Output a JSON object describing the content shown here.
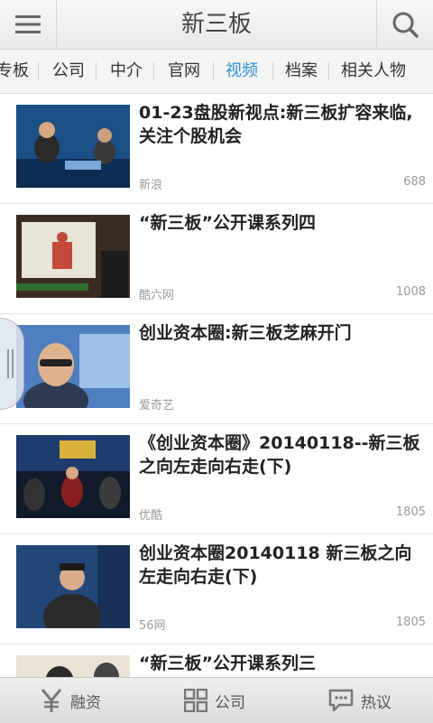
{
  "header": {
    "title": "新三板"
  },
  "tabs": [
    {
      "label": "专板"
    },
    {
      "label": "公司"
    },
    {
      "label": "中介"
    },
    {
      "label": "官网"
    },
    {
      "label": "视频",
      "active": true
    },
    {
      "label": "档案"
    },
    {
      "label": "相关人物"
    }
  ],
  "videos": [
    {
      "title": "01-23盘股新视点:新三板扩容来临,关注个股机会",
      "source": "新浪",
      "count": "688"
    },
    {
      "title": "“新三板”公开课系列四",
      "source": "酷六网",
      "count": "1008"
    },
    {
      "title": "创业资本圈:新三板芝麻开门",
      "source": "爱奇艺",
      "count": ""
    },
    {
      "title": "《创业资本圈》20140118--新三板之向左走向右走(下)",
      "source": "优酷",
      "count": "1805"
    },
    {
      "title": "创业资本圈20140118 新三板之向左走向右走(下)",
      "source": "56网",
      "count": "1805"
    },
    {
      "title": "“新三板”公开课系列三",
      "source": "",
      "count": ""
    }
  ],
  "bottom_nav": [
    {
      "label": "融资",
      "icon": "yen-icon"
    },
    {
      "label": "公司",
      "icon": "grid-icon"
    },
    {
      "label": "热议",
      "icon": "chat-icon"
    }
  ],
  "colors": {
    "active_tab": "#2f8fd1",
    "muted_text": "#9a9a9a"
  }
}
